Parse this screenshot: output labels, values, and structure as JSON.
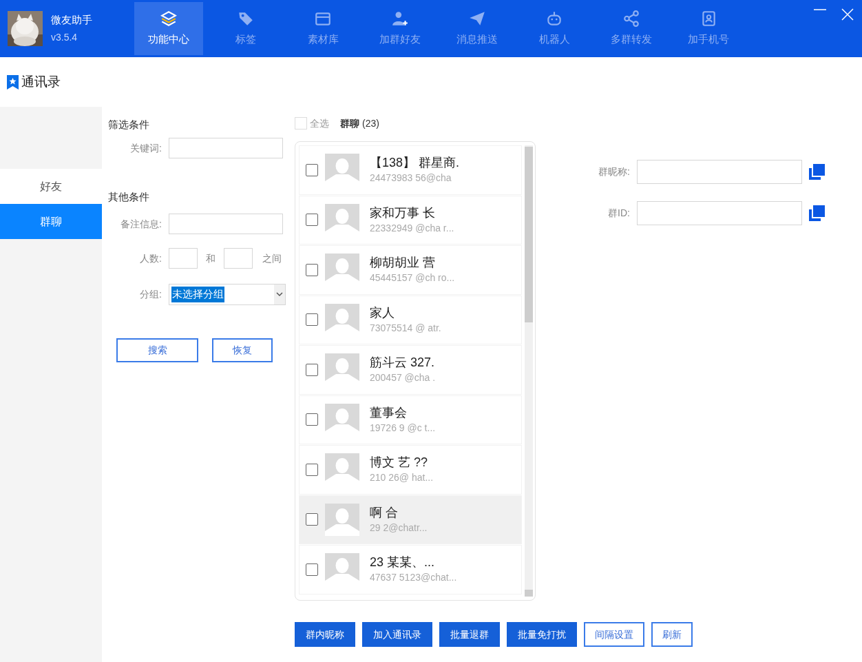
{
  "app": {
    "name": "微友助手",
    "version": "v3.5.4"
  },
  "nav": [
    {
      "label": "功能中心",
      "selected": true
    },
    {
      "label": "标签",
      "selected": false
    },
    {
      "label": "素材库",
      "selected": false
    },
    {
      "label": "加群好友",
      "selected": false
    },
    {
      "label": "消息推送",
      "selected": false
    },
    {
      "label": "机器人",
      "selected": false
    },
    {
      "label": "多群转发",
      "selected": false
    },
    {
      "label": "加手机号",
      "selected": false
    }
  ],
  "page_title": "通讯录",
  "sidebar": {
    "items": [
      {
        "label": "好友",
        "selected": false
      },
      {
        "label": "群聊",
        "selected": true
      }
    ]
  },
  "filter": {
    "title": "筛选条件",
    "keyword_label": "关键词:",
    "other_title": "其他条件",
    "remark_label": "备注信息:",
    "count_label": "人数:",
    "count_and": "和",
    "count_between": "之间",
    "group_label": "分组:",
    "group_value": "未选择分组",
    "buttons": [
      "搜索",
      "恢复"
    ]
  },
  "list": {
    "select_all": {
      "label": "全选",
      "checked": false
    },
    "heading": "群聊",
    "count": "(23)",
    "rows": [
      {
        "name": "【138】 群星商.",
        "id": "24473983 56@cha",
        "checked": false,
        "selected": false
      },
      {
        "name": "家和万事 长",
        "id": "22332949 @cha r...",
        "checked": false,
        "selected": false
      },
      {
        "name": "柳胡胡业 营",
        "id": "45445157 @ch ro...",
        "checked": false,
        "selected": false
      },
      {
        "name": "家人",
        "id": "73075514 @ atr.",
        "checked": false,
        "selected": false
      },
      {
        "name": "筋斗云 327.",
        "id": "200457 @cha .",
        "checked": false,
        "selected": false
      },
      {
        "name": "董事会",
        "id": "19726 9 @c t...",
        "checked": false,
        "selected": false
      },
      {
        "name": "博文 艺 ??",
        "id": "210 26@ hat...",
        "checked": false,
        "selected": false
      },
      {
        "name": "啊 合",
        "id": "29 2@chatr...",
        "checked": false,
        "selected": true
      },
      {
        "name": "23 某某、...",
        "id": "47637 5123@chat...",
        "checked": false,
        "selected": false
      }
    ]
  },
  "details": [
    {
      "label": "群昵称:"
    },
    {
      "label": "群ID:"
    }
  ],
  "actions": [
    {
      "label": "群内昵称",
      "kind": "filled"
    },
    {
      "label": "加入通讯录",
      "kind": "filled"
    },
    {
      "label": "批量退群",
      "kind": "filled"
    },
    {
      "label": "批量免打扰",
      "kind": "filled"
    },
    {
      "label": "间隔设置",
      "kind": "outline"
    },
    {
      "label": "刷新",
      "kind": "outline"
    }
  ]
}
